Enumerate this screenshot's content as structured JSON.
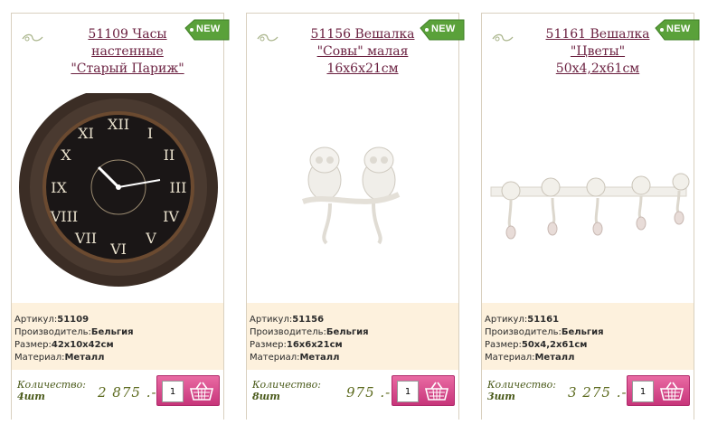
{
  "products": [
    {
      "title_lines": [
        "51109 Часы",
        "настенные",
        "\"Старый Париж\""
      ],
      "badge": "NEW",
      "image": "clock-image",
      "specs": [
        {
          "label": "Артикул:",
          "value": "51109"
        },
        {
          "label": "Производитель:",
          "value": "Бельгия"
        },
        {
          "label": "Размер:",
          "value": "42x10x42см"
        },
        {
          "label": "Материал:",
          "value": "Металл"
        }
      ],
      "qty_label": "Количество:",
      "stock": "4шт",
      "price": "2 875 .-",
      "qty_value": "1"
    },
    {
      "title_lines": [
        "51156 Вешалка",
        "\"Совы\" малая",
        "16x6x21см"
      ],
      "badge": "NEW",
      "image": "owl-hanger-image",
      "specs": [
        {
          "label": "Артикул:",
          "value": "51156"
        },
        {
          "label": "Производитель:",
          "value": "Бельгия"
        },
        {
          "label": "Размер:",
          "value": "16x6x21см"
        },
        {
          "label": "Материал:",
          "value": "Металл"
        }
      ],
      "qty_label": "Количество:",
      "stock": "8шт",
      "price": "975 .-",
      "qty_value": "1"
    },
    {
      "title_lines": [
        "51161 Вешалка",
        "\"Цветы\"",
        "50x4,2x61см"
      ],
      "badge": "NEW",
      "image": "flower-hanger-image",
      "specs": [
        {
          "label": "Артикул:",
          "value": "51161"
        },
        {
          "label": "Производитель:",
          "value": "Бельгия"
        },
        {
          "label": "Размер:",
          "value": "50x4,2x61см"
        },
        {
          "label": "Материал:",
          "value": "Металл"
        }
      ],
      "qty_label": "Количество:",
      "stock": "3шт",
      "price": "3 275 .-",
      "qty_value": "1"
    }
  ],
  "colors": {
    "title": "#6a1f3f",
    "badge": "#5aa13a",
    "specs_bg": "#fdf1dd",
    "cart": "#d6478a",
    "price": "#5c6a1e"
  }
}
